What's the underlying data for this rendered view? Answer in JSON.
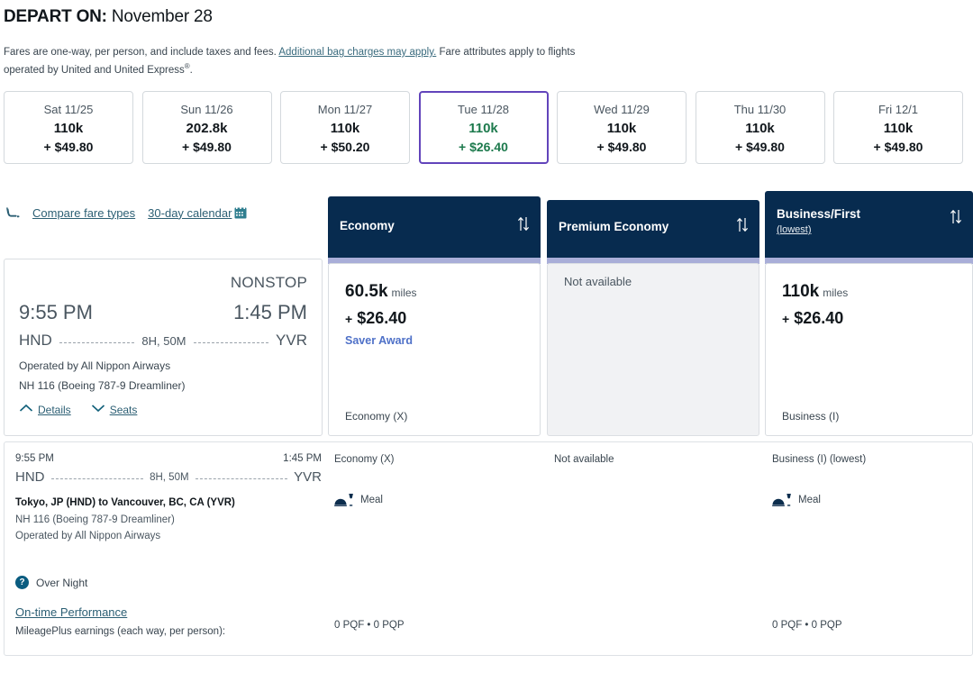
{
  "header": {
    "depart_label": "DEPART ON:",
    "depart_date": "November 28"
  },
  "disclaimer": {
    "part1": "Fares are one-way, per person, and include taxes and fees. ",
    "link": "Additional bag charges may apply.",
    "part2": " Fare attributes apply to flights operated by United and United Express",
    "sup": "®",
    "period": "."
  },
  "date_strip": [
    {
      "dow": "Sat 11/25",
      "miles": "110k",
      "cash": "+ $49.80",
      "selected": false
    },
    {
      "dow": "Sun 11/26",
      "miles": "202.8k",
      "cash": "+ $49.80",
      "selected": false
    },
    {
      "dow": "Mon 11/27",
      "miles": "110k",
      "cash": "+ $50.20",
      "selected": false
    },
    {
      "dow": "Tue 11/28",
      "miles": "110k",
      "cash": "+ $26.40",
      "selected": true
    },
    {
      "dow": "Wed 11/29",
      "miles": "110k",
      "cash": "+ $49.80",
      "selected": false
    },
    {
      "dow": "Thu 11/30",
      "miles": "110k",
      "cash": "+ $49.80",
      "selected": false
    },
    {
      "dow": "Fri 12/1",
      "miles": "110k",
      "cash": "+ $49.80",
      "selected": false
    }
  ],
  "links": {
    "compare_fare_types": "Compare fare types",
    "thirty_day_calendar": "30-day calendar",
    "seat_icon": "seat-icon",
    "calendar_icon": "calendar-icon"
  },
  "fare_columns": [
    {
      "title": "Economy",
      "sub": "",
      "sort_icon": "sort-arrows-icon"
    },
    {
      "title": "Premium Economy",
      "sub": "",
      "sort_icon": "sort-arrows-icon"
    },
    {
      "title": "Business/First",
      "sub": "(lowest)",
      "sort_icon": "sort-arrows-icon"
    }
  ],
  "flight": {
    "stops": "NONSTOP",
    "depart_time": "9:55 PM",
    "arrive_time": "1:45 PM",
    "origin": "HND",
    "destination": "YVR",
    "duration": "8H, 50M",
    "operated_by": "Operated by All Nippon Airways",
    "equipment": "NH 116 (Boeing 787-9 Dreamliner)",
    "details_label": "Details",
    "seats_label": "Seats",
    "details_icon": "chevron-up-icon",
    "seats_icon": "chevron-down-icon"
  },
  "fares": {
    "economy": {
      "miles": "60.5k",
      "miles_unit": "miles",
      "cash_plus": "+",
      "cash": "$26.40",
      "award_tag": "Saver Award",
      "class_label": "Economy (X)",
      "available": true
    },
    "premium_economy": {
      "not_available": "Not available",
      "available": false
    },
    "business_first": {
      "miles": "110k",
      "miles_unit": "miles",
      "cash_plus": "+",
      "cash": "$26.40",
      "award_tag": "",
      "class_label": "Business (I)",
      "available": true
    }
  },
  "details_panel": {
    "depart_time": "9:55 PM",
    "arrive_time": "1:45 PM",
    "origin": "HND",
    "destination": "YVR",
    "duration": "8H, 50M",
    "city_pair": "Tokyo, JP (HND) to Vancouver, BC, CA (YVR)",
    "equipment": "NH 116 (Boeing 787-9 Dreamliner)",
    "operated_by": "Operated by All Nippon Airways",
    "overnight_icon": "question-mark-icon",
    "overnight_label": "Over Night",
    "on_time_performance": "On-time Performance",
    "earnings_label": "MileagePlus earnings (each way, per person):",
    "columns": [
      {
        "class_label": "Economy (X)",
        "amenity": "Meal",
        "amenity_icon": "meal-icon",
        "earnings": "0 PQF • 0 PQP"
      },
      {
        "class_label": "Not available",
        "amenity": "",
        "amenity_icon": "",
        "earnings": ""
      },
      {
        "class_label": "Business (I) (lowest)",
        "amenity": "Meal",
        "amenity_icon": "meal-icon",
        "earnings": "0 PQF • 0 PQP"
      }
    ]
  },
  "colors": {
    "navy": "#072b4f",
    "lavender_bar": "#a9aed8",
    "selected_border": "#6244bb",
    "selected_text": "#1d7a4d",
    "link": "#2c5f74",
    "saver_award": "#4f71c8"
  }
}
